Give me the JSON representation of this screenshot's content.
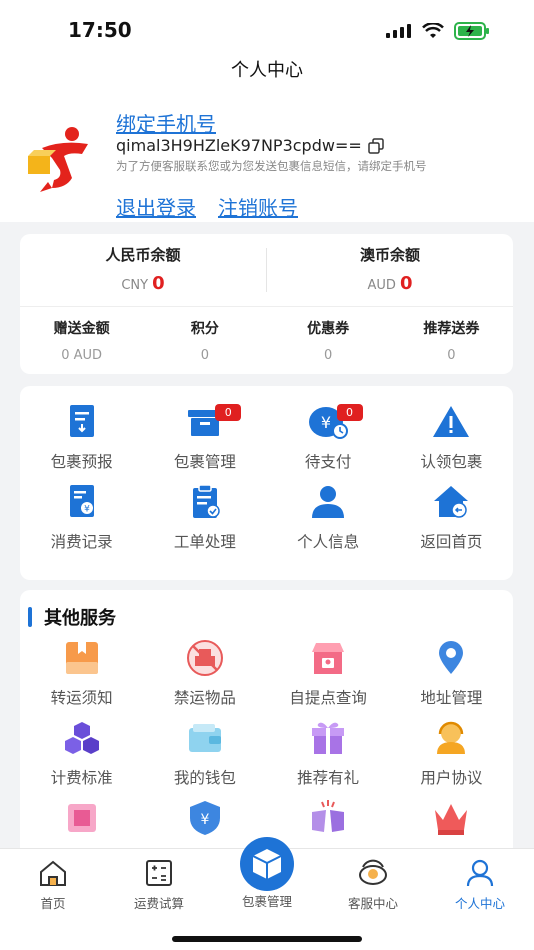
{
  "status": {
    "time": "17:50"
  },
  "nav": {
    "title": "个人中心"
  },
  "profile": {
    "bind_phone": "绑定手机号",
    "account_id": "qimal3H9HZleK97NP3cpdw==",
    "bind_tip": "为了方便客服联系您或为您发送包裹信息短信，请绑定手机号",
    "logout": "退出登录",
    "cancel_account": "注销账号"
  },
  "balance": {
    "rmb": {
      "label": "人民币余额",
      "currency": "CNY",
      "value": "0"
    },
    "aud": {
      "label": "澳币余额",
      "currency": "AUD",
      "value": "0"
    },
    "stats": [
      {
        "label": "赠送金额",
        "value": "0 AUD"
      },
      {
        "label": "积分",
        "value": "0"
      },
      {
        "label": "优惠券",
        "value": "0"
      },
      {
        "label": "推荐送券",
        "value": "0"
      }
    ]
  },
  "actions": [
    {
      "label": "包裹预报",
      "icon": "forecast-icon"
    },
    {
      "label": "包裹管理",
      "icon": "box-manage-icon",
      "badge": "0"
    },
    {
      "label": "待支付",
      "icon": "pending-pay-icon",
      "badge": "0"
    },
    {
      "label": "认领包裹",
      "icon": "claim-warning-icon"
    },
    {
      "label": "消费记录",
      "icon": "expense-record-icon"
    },
    {
      "label": "工单处理",
      "icon": "clipboard-check-icon"
    },
    {
      "label": "个人信息",
      "icon": "user-icon"
    },
    {
      "label": "返回首页",
      "icon": "home-return-icon"
    }
  ],
  "services": {
    "title": "其他服务",
    "items": [
      {
        "label": "转运须知",
        "icon": "book-icon"
      },
      {
        "label": "禁运物品",
        "icon": "prohibited-icon"
      },
      {
        "label": "自提点查询",
        "icon": "pickup-store-icon"
      },
      {
        "label": "地址管理",
        "icon": "location-pin-icon"
      },
      {
        "label": "计费标准",
        "icon": "cubes-icon"
      },
      {
        "label": "我的钱包",
        "icon": "wallet-icon"
      },
      {
        "label": "推荐有礼",
        "icon": "gift-icon"
      },
      {
        "label": "用户协议",
        "icon": "support-agent-icon"
      }
    ]
  },
  "tabbar": {
    "home": "首页",
    "calc": "运费试算",
    "parcel": "包裹管理",
    "service": "客服中心",
    "profile": "个人中心"
  },
  "colors": {
    "accent": "#1e73d6",
    "badge": "#e02020"
  }
}
